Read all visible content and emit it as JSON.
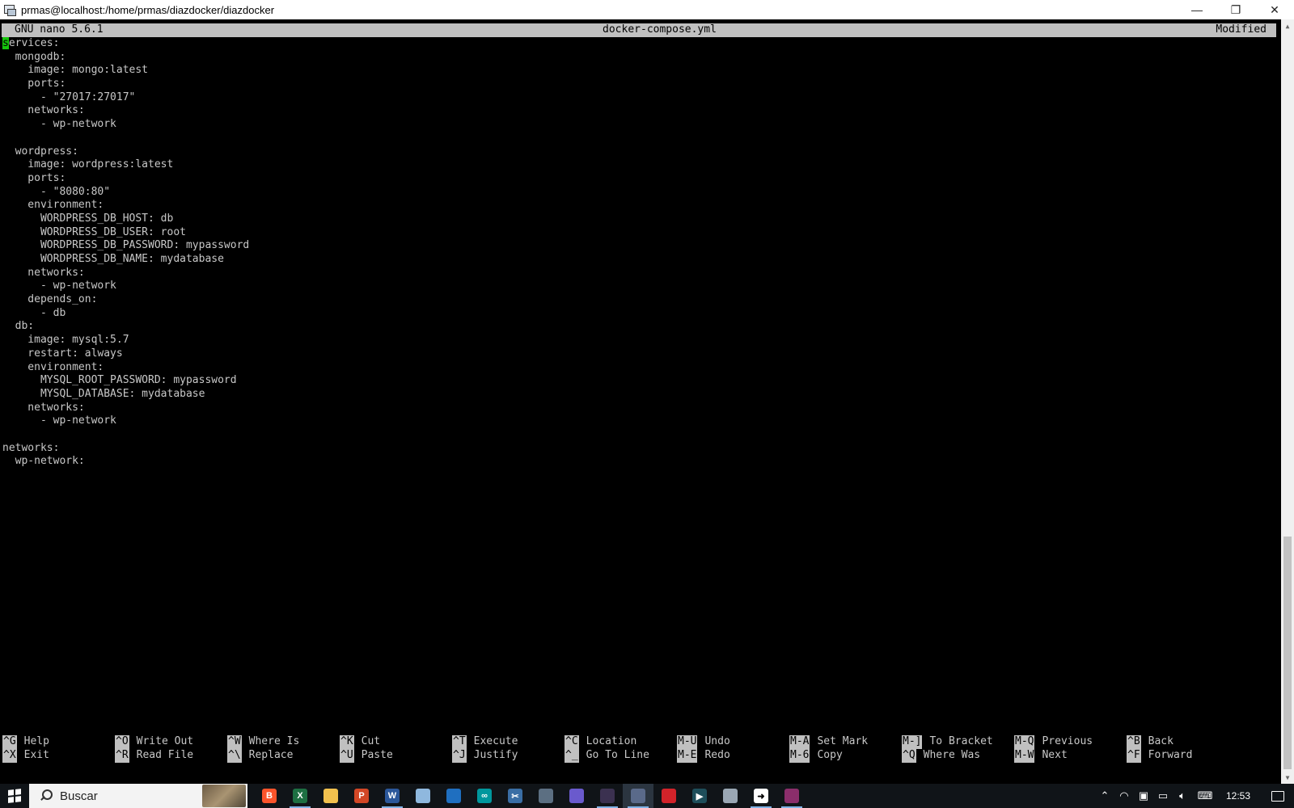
{
  "window": {
    "title": "prmas@localhost:/home/prmas/diazdocker/diazdocker",
    "minimize": "—",
    "restore": "❐",
    "close": "✕"
  },
  "nano": {
    "version": "GNU nano 5.6.1",
    "filename": "docker-compose.yml",
    "status": "Modified",
    "cursor_char": "s",
    "first_line_rest": "ervices:",
    "lines": [
      "  mongodb:",
      "    image: mongo:latest",
      "    ports:",
      "      - \"27017:27017\"",
      "    networks:",
      "      - wp-network",
      "",
      "  wordpress:",
      "    image: wordpress:latest",
      "    ports:",
      "      - \"8080:80\"",
      "    environment:",
      "      WORDPRESS_DB_HOST: db",
      "      WORDPRESS_DB_USER: root",
      "      WORDPRESS_DB_PASSWORD: mypassword",
      "      WORDPRESS_DB_NAME: mydatabase",
      "    networks:",
      "      - wp-network",
      "    depends_on:",
      "      - db",
      "  db:",
      "    image: mysql:5.7",
      "    restart: always",
      "    environment:",
      "      MYSQL_ROOT_PASSWORD: mypassword",
      "      MYSQL_DATABASE: mydatabase",
      "    networks:",
      "      - wp-network",
      "",
      "networks:",
      "  wp-network:"
    ],
    "shortcuts": [
      [
        {
          "key": "^G",
          "label": "Help"
        },
        {
          "key": "^X",
          "label": "Exit"
        }
      ],
      [
        {
          "key": "^O",
          "label": "Write Out"
        },
        {
          "key": "^R",
          "label": "Read File"
        }
      ],
      [
        {
          "key": "^W",
          "label": "Where Is"
        },
        {
          "key": "^\\",
          "label": "Replace"
        }
      ],
      [
        {
          "key": "^K",
          "label": "Cut"
        },
        {
          "key": "^U",
          "label": "Paste"
        }
      ],
      [
        {
          "key": "^T",
          "label": "Execute"
        },
        {
          "key": "^J",
          "label": "Justify"
        }
      ],
      [
        {
          "key": "^C",
          "label": "Location"
        },
        {
          "key": "^_",
          "label": "Go To Line"
        }
      ],
      [
        {
          "key": "M-U",
          "label": "Undo"
        },
        {
          "key": "M-E",
          "label": "Redo"
        }
      ],
      [
        {
          "key": "M-A",
          "label": "Set Mark"
        },
        {
          "key": "M-6",
          "label": "Copy"
        }
      ],
      [
        {
          "key": "M-]",
          "label": "To Bracket"
        },
        {
          "key": "^Q",
          "label": "Where Was"
        }
      ],
      [
        {
          "key": "M-Q",
          "label": "Previous"
        },
        {
          "key": "M-W",
          "label": "Next"
        }
      ],
      [
        {
          "key": "^B",
          "label": "Back"
        },
        {
          "key": "^F",
          "label": "Forward"
        }
      ]
    ]
  },
  "taskbar": {
    "search_placeholder": "Buscar",
    "clock": "12:53",
    "apps": [
      {
        "name": "brave-icon",
        "glyph": "B",
        "color": "#fb542b"
      },
      {
        "name": "excel-icon",
        "glyph": "X",
        "color": "#1d6f42"
      },
      {
        "name": "file-explorer-icon",
        "glyph": "",
        "color": "#f2c14e"
      },
      {
        "name": "powerpoint-icon",
        "glyph": "P",
        "color": "#d24726"
      },
      {
        "name": "word-icon",
        "glyph": "W",
        "color": "#2b579a"
      },
      {
        "name": "notepad-icon",
        "glyph": "",
        "color": "#8fb8de"
      },
      {
        "name": "virtualbox-icon",
        "glyph": "",
        "color": "#1f6fc0"
      },
      {
        "name": "arduino-icon",
        "glyph": "∞",
        "color": "#00979d"
      },
      {
        "name": "snipping-tool-icon",
        "glyph": "✂",
        "color": "#3a6ea5"
      },
      {
        "name": "photos-icon",
        "glyph": "",
        "color": "#5c6f82"
      },
      {
        "name": "database-app-icon",
        "glyph": "",
        "color": "#6a5acd"
      },
      {
        "name": "dark-app-icon",
        "glyph": "",
        "color": "#3b3150"
      },
      {
        "name": "putty-icon",
        "glyph": "",
        "color": "#5a6a8a"
      },
      {
        "name": "remote-app-icon",
        "glyph": "",
        "color": "#d2232a"
      },
      {
        "name": "terminal-app-icon",
        "glyph": "▶",
        "color": "#1e4e5a"
      },
      {
        "name": "browser-icon",
        "glyph": "",
        "color": "#9aa7b4"
      },
      {
        "name": "arrow-app-icon",
        "glyph": "➜",
        "color": "#ffffff"
      },
      {
        "name": "winrar-icon",
        "glyph": "",
        "color": "#8b2e6b"
      }
    ]
  }
}
